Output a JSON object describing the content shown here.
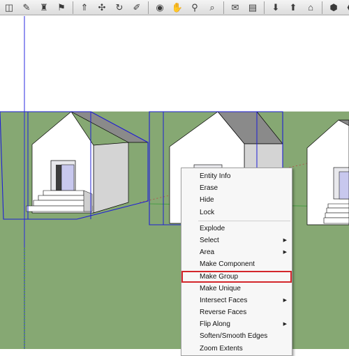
{
  "toolbar": {
    "buttons": [
      {
        "name": "select-icon",
        "glyph": "◫"
      },
      {
        "name": "eraser-icon",
        "glyph": "✎"
      },
      {
        "name": "paint-bucket-icon",
        "glyph": "♜"
      },
      {
        "name": "walk-icon",
        "glyph": "⚑"
      },
      {
        "sep": true
      },
      {
        "name": "push-pull-icon",
        "glyph": "⇑"
      },
      {
        "name": "move-icon",
        "glyph": "✣"
      },
      {
        "name": "rotate-icon",
        "glyph": "↻"
      },
      {
        "name": "follow-me-icon",
        "glyph": "✐"
      },
      {
        "sep": true
      },
      {
        "name": "orbit-icon",
        "glyph": "◉"
      },
      {
        "name": "pan-icon",
        "glyph": "✋"
      },
      {
        "name": "zoom-icon",
        "glyph": "⚲"
      },
      {
        "name": "zoom-extents-icon",
        "glyph": "⌕"
      },
      {
        "sep": true
      },
      {
        "name": "text-icon",
        "glyph": "✉"
      },
      {
        "name": "section-plane-icon",
        "glyph": "▤"
      },
      {
        "sep": true
      },
      {
        "name": "get-models-icon",
        "glyph": "⬇"
      },
      {
        "name": "share-model-icon",
        "glyph": "⬆"
      },
      {
        "name": "warehouse-icon",
        "glyph": "⌂"
      },
      {
        "sep": true
      },
      {
        "name": "components-icon",
        "glyph": "⬢"
      },
      {
        "name": "extensions-icon",
        "glyph": "⬣"
      }
    ]
  },
  "colors": {
    "sky": "#ffffff",
    "ground": "#86a873",
    "selection": "#1f1fd6",
    "menu_highlight_border": "#d3262b"
  },
  "context_menu": {
    "items": [
      {
        "label": "Entity Info",
        "submenu": false
      },
      {
        "label": "Erase",
        "submenu": false
      },
      {
        "label": "Hide",
        "submenu": false
      },
      {
        "label": "Lock",
        "submenu": false
      },
      {
        "sep": true
      },
      {
        "label": "Explode",
        "submenu": false
      },
      {
        "label": "Select",
        "submenu": true
      },
      {
        "label": "Area",
        "submenu": true
      },
      {
        "label": "Make Component",
        "submenu": false
      },
      {
        "label": "Make Group",
        "submenu": false,
        "highlighted": true
      },
      {
        "label": "Make Unique",
        "submenu": false
      },
      {
        "label": "Intersect Faces",
        "submenu": true
      },
      {
        "label": "Reverse Faces",
        "submenu": false
      },
      {
        "label": "Flip Along",
        "submenu": true
      },
      {
        "label": "Soften/Smooth Edges",
        "submenu": false
      },
      {
        "label": "Zoom Extents",
        "submenu": false
      }
    ]
  }
}
